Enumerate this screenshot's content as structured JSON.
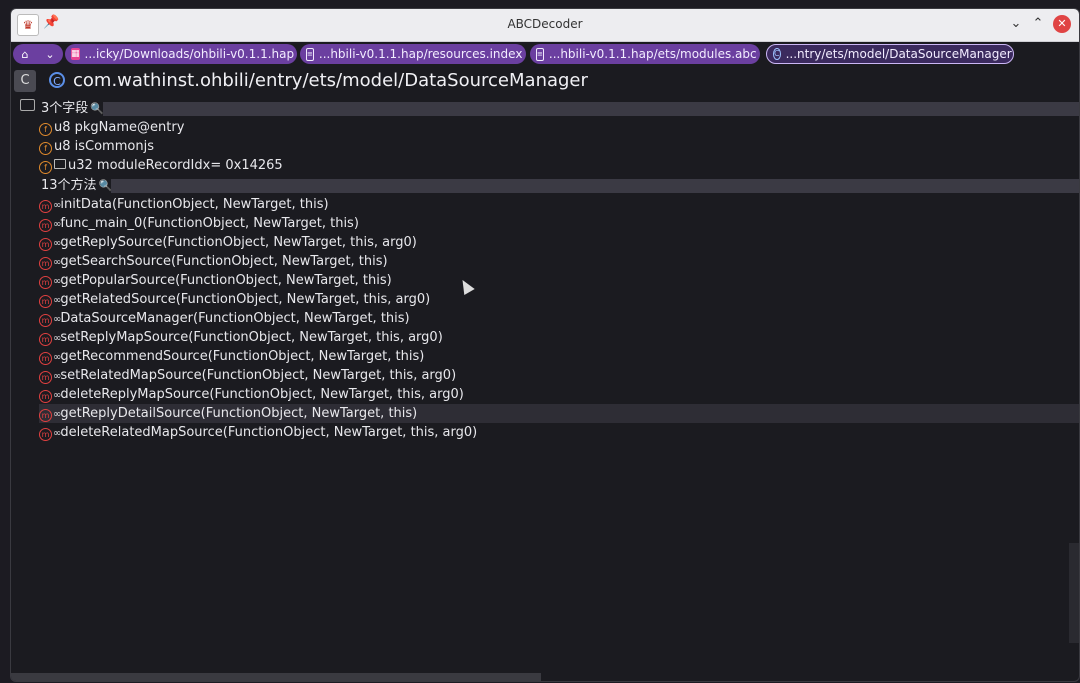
{
  "window": {
    "title": "ABCDecoder",
    "close_glyph": "✕",
    "min_glyph": "⌄",
    "max_glyph": "⌃"
  },
  "tabs": [
    {
      "label": "...icky/Downloads/ohbili-v0.1.1.hap",
      "icon": "hap-file-icon"
    },
    {
      "label": "...hbili-v0.1.1.hap/resources.index",
      "icon": "document-icon"
    },
    {
      "label": "...hbili-v0.1.1.hap/ets/modules.abc",
      "icon": "document-icon"
    },
    {
      "label": "...ntry/ets/model/DataSourceManager",
      "icon": "class-icon",
      "active": true
    }
  ],
  "header": {
    "class_name": "com.wathinst.ohbili/entry/ets/model/DataSourceManager"
  },
  "fields_section": {
    "title": "3个字段",
    "items": [
      {
        "text": "u8 pkgName@entry"
      },
      {
        "text": "u8 isCommonjs"
      },
      {
        "text": "u32 moduleRecordIdx= 0x14265"
      }
    ]
  },
  "methods_section": {
    "title": "13个方法",
    "items": [
      {
        "text": "initData(FunctionObject, NewTarget, this)"
      },
      {
        "text": "func_main_0(FunctionObject, NewTarget, this)"
      },
      {
        "text": "getReplySource(FunctionObject, NewTarget, this, arg0)"
      },
      {
        "text": "getSearchSource(FunctionObject, NewTarget, this)"
      },
      {
        "text": "getPopularSource(FunctionObject, NewTarget, this)"
      },
      {
        "text": "getRelatedSource(FunctionObject, NewTarget, this, arg0)"
      },
      {
        "text": "DataSourceManager(FunctionObject, NewTarget, this)"
      },
      {
        "text": "setReplyMapSource(FunctionObject, NewTarget, this, arg0)"
      },
      {
        "text": "getRecommendSource(FunctionObject, NewTarget, this)"
      },
      {
        "text": "setRelatedMapSource(FunctionObject, NewTarget, this, arg0)"
      },
      {
        "text": "deleteReplyMapSource(FunctionObject, NewTarget, this, arg0)"
      },
      {
        "text": "getReplyDetailSource(FunctionObject, NewTarget, this)",
        "highlighted": true
      },
      {
        "text": "deleteRelatedMapSource(FunctionObject, NewTarget, this, arg0)"
      }
    ]
  }
}
